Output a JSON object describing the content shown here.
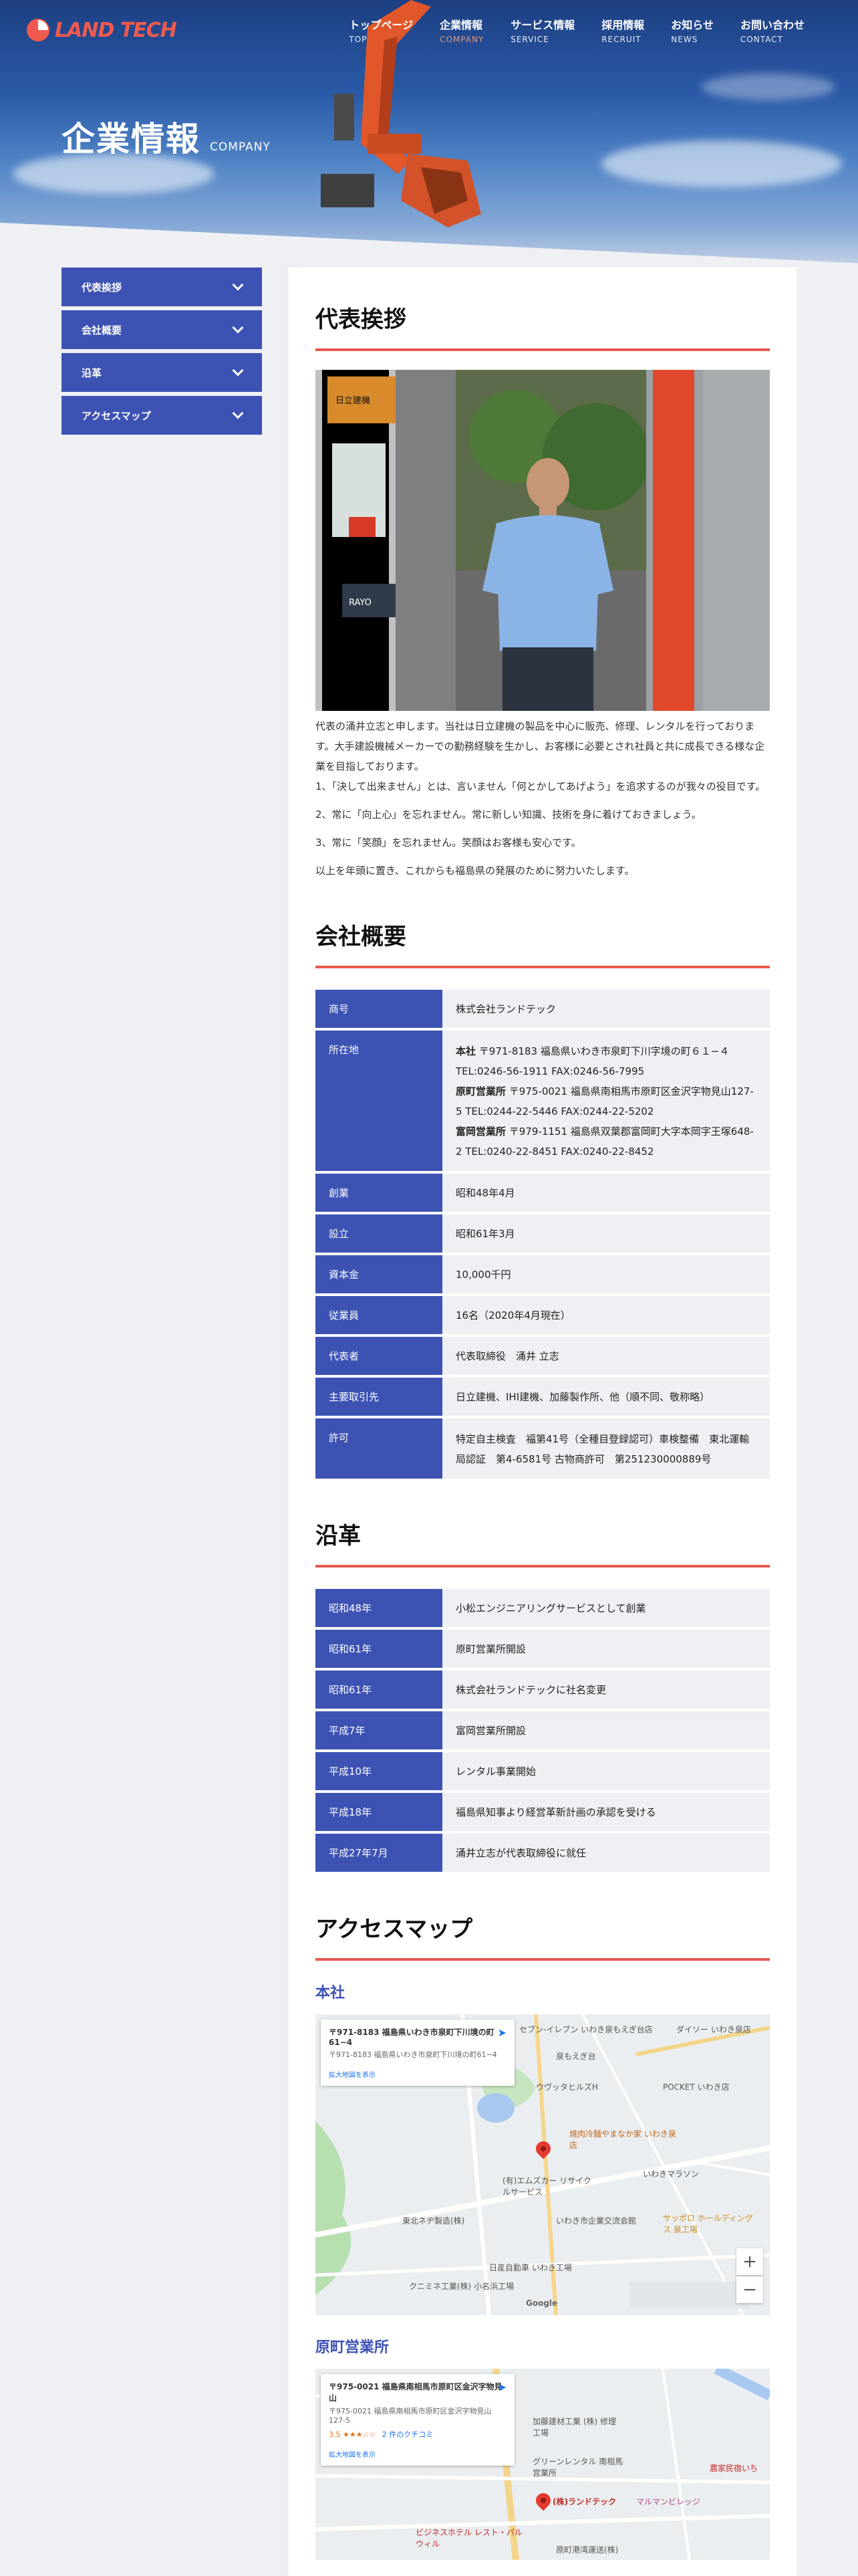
{
  "header": {
    "logo_text": "LAND TECH",
    "nav": [
      {
        "jp": "トップページ",
        "en": "TOP"
      },
      {
        "jp": "企業情報",
        "en": "COMPANY"
      },
      {
        "jp": "サービス情報",
        "en": "SERVICE"
      },
      {
        "jp": "採用情報",
        "en": "RECRUIT"
      },
      {
        "jp": "お知らせ",
        "en": "NEWS"
      },
      {
        "jp": "お問い合わせ",
        "en": "CONTACT"
      }
    ],
    "page_title": "企業情報",
    "page_title_en": "COMPANY"
  },
  "sidebar": {
    "items": [
      {
        "label": "代表挨拶"
      },
      {
        "label": "会社概要"
      },
      {
        "label": "沿革"
      },
      {
        "label": "アクセスマップ"
      }
    ]
  },
  "greeting": {
    "title": "代表挨拶",
    "photo_sign_1": "日立建機",
    "photo_sign_2": "RAYO",
    "p1": "代表の涌井立志と申します。当社は日立建機の製品を中心に販売、修理、レンタルを行っております。大手建設機械メーカーでの勤務経験を生かし、お客様に必要とされ社員と共に成長できる様な企業を目指しております。",
    "p2": "1、「決して出来ません」とは、言いません「何とかしてあげよう」を追求するのが我々の役目です。",
    "p3": "2、常に「向上心」を忘れません。常に新しい知識、技術を身に着けておきましょう。",
    "p4": "3、常に「笑顔」を忘れません。笑顔はお客様も安心です。",
    "p5": "以上を年頭に置き、これからも福島県の発展のために努力いたします。"
  },
  "overview": {
    "title": "会社概要",
    "rows": {
      "name": {
        "th": "商号",
        "td": "株式会社ランドテック"
      },
      "address": {
        "th": "所在地",
        "o1_name": "本社",
        "o1_addr": "〒971-8183 福島県いわき市泉町下川字境の町６１−４",
        "o1_tel": "TEL:0246-56-1911 FAX:0246-56-7995",
        "o2_name": "原町営業所",
        "o2_addr": "〒975-0021 福島県南相馬市原町区金沢字物見山127-5 TEL:0244-22-5446 FAX:0244-22-5202",
        "o3_name": "富岡営業所",
        "o3_addr": "〒979-1151 福島県双葉郡富岡町大字本岡字王塚648-2 TEL:0240-22-8451 FAX:0240-22-8452"
      },
      "founded": {
        "th": "創業",
        "td": "昭和48年4月"
      },
      "established": {
        "th": "設立",
        "td": "昭和61年3月"
      },
      "capital": {
        "th": "資本金",
        "td": "10,000千円"
      },
      "employees": {
        "th": "従業員",
        "td": "16名（2020年4月現在）"
      },
      "ceo": {
        "th": "代表者",
        "td": "代表取締役　涌井 立志"
      },
      "clients": {
        "th": "主要取引先",
        "td": "日立建機、IHI建機、加藤製作所、他（順不同、敬称略）"
      },
      "license": {
        "th": "許可",
        "td": "特定自主検査　福第41号（全種目登録認可）車検整備　東北運輸局認証　第4-6581号 古物商許可　第251230000889号"
      }
    }
  },
  "history": {
    "title": "沿革",
    "rows": [
      {
        "year": "昭和48年",
        "event": "小松エンジニアリングサービスとして創業"
      },
      {
        "year": "昭和61年",
        "event": "原町営業所開設"
      },
      {
        "year": "昭和61年",
        "event": "株式会社ランドテックに社名変更"
      },
      {
        "year": "平成7年",
        "event": "富岡営業所開設"
      },
      {
        "year": "平成10年",
        "event": "レンタル事業開始"
      },
      {
        "year": "平成18年",
        "event": "福島県知事より経営革新計画の承認を受ける"
      },
      {
        "year": "平成27年7月",
        "event": "涌井立志が代表取締役に就任"
      }
    ]
  },
  "access": {
    "title": "アクセスマップ",
    "map1": {
      "heading": "本社",
      "card_name": "〒971-8183 福島県いわき市泉町下川境の町61−4",
      "card_addr": "〒971-8183 福島県いわき市泉町下川境の町61−4",
      "card_link": "拡大地図を表示",
      "labels": [
        "セブン-イレブン いわき泉もえぎ台店",
        "泉もえぎ台",
        "ダイソー いわき泉店",
        "ウヴッタヒルズH",
        "POCKET いわき店",
        "焼肉冷麺やまなか家 いわき泉店",
        "(有)エムズカー リサイクルサービス",
        "いわきマラソン",
        "東北ネヂ製造(株)",
        "いわき市企業交流会館",
        "サッポロ ホールディングス 泉工場",
        "日産自動車 いわき工場",
        "クニミネ工業(株) 小名浜工場",
        "Google"
      ]
    },
    "map2": {
      "heading": "原町営業所",
      "card_name": "〒975-0021 福島県南相馬市原町区金沢字物見山",
      "card_addr": "〒975-0021 福島県南相馬市原町区金沢字物見山127-5",
      "card_rating": "3.5 ★★★☆☆",
      "card_reviews": "2 件のクチコミ",
      "card_link": "拡大地図を表示",
      "labels": [
        "加藤建材工業 (株) 修理工場",
        "グリーンレンタル 南相馬営業所",
        "(株)ランドテック",
        "マルマンビレッジ",
        "農家民宿いち",
        "ビジネスホテル レスト・パル ウィル",
        "原町港湾運送(株)"
      ]
    }
  },
  "colors": {
    "accent": "#e85a4f",
    "brand_blue": "#3d52b3",
    "row_bg": "#eef0f4"
  }
}
